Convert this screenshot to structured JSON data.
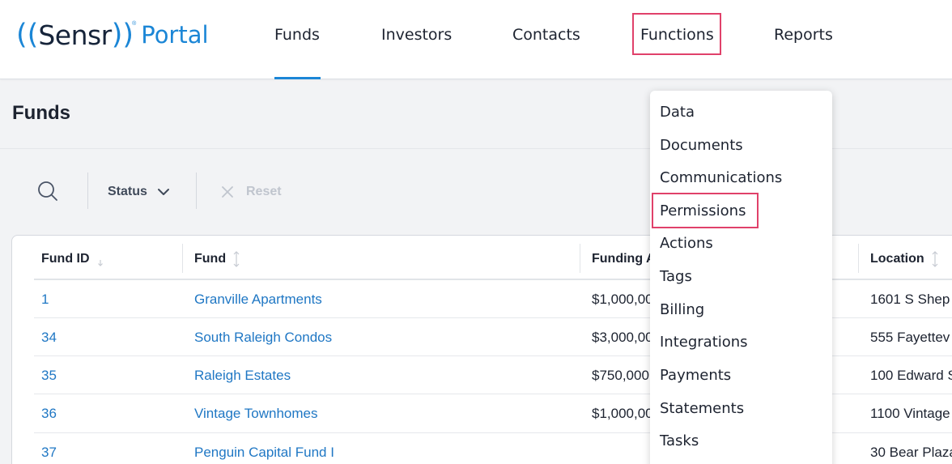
{
  "header": {
    "logo": {
      "open": "((",
      "name": "Sensr",
      "close": "))",
      "reg": "®",
      "product": "Portal"
    },
    "nav": [
      {
        "label": "Funds",
        "active": true
      },
      {
        "label": "Investors"
      },
      {
        "label": "Contacts"
      },
      {
        "label": "Functions",
        "highlighted": true
      },
      {
        "label": "Reports"
      }
    ]
  },
  "page": {
    "title": "Funds"
  },
  "filters": {
    "search_icon": "search-icon",
    "status_label": "Status",
    "reset_label": "Reset"
  },
  "table": {
    "columns": [
      "Fund ID",
      "Fund",
      "Funding A",
      "Location"
    ],
    "rows": [
      {
        "id": "1",
        "fund": "Granville Apartments",
        "funding": "$1,000,00",
        "location": "1601 S Shep"
      },
      {
        "id": "34",
        "fund": "South Raleigh Condos",
        "funding": "$3,000,00",
        "location": "555 Fayettev"
      },
      {
        "id": "35",
        "fund": "Raleigh Estates",
        "funding": "$750,000",
        "location": "100 Edward S"
      },
      {
        "id": "36",
        "fund": "Vintage Townhomes",
        "funding": "$1,000,00",
        "location": "1100 Vintage"
      },
      {
        "id": "37",
        "fund": "Penguin Capital Fund I",
        "funding": "",
        "location": "30 Bear Plaza"
      }
    ]
  },
  "menu": {
    "items": [
      {
        "label": "Data"
      },
      {
        "label": "Documents"
      },
      {
        "label": "Communications"
      },
      {
        "label": "Permissions",
        "highlighted": true
      },
      {
        "label": "Actions"
      },
      {
        "label": "Tags"
      },
      {
        "label": "Billing"
      },
      {
        "label": "Integrations"
      },
      {
        "label": "Payments"
      },
      {
        "label": "Statements"
      },
      {
        "label": "Tasks"
      }
    ]
  },
  "colors": {
    "brand": "#1b86d6",
    "highlight": "#e0416a",
    "link": "#1f77c4"
  }
}
